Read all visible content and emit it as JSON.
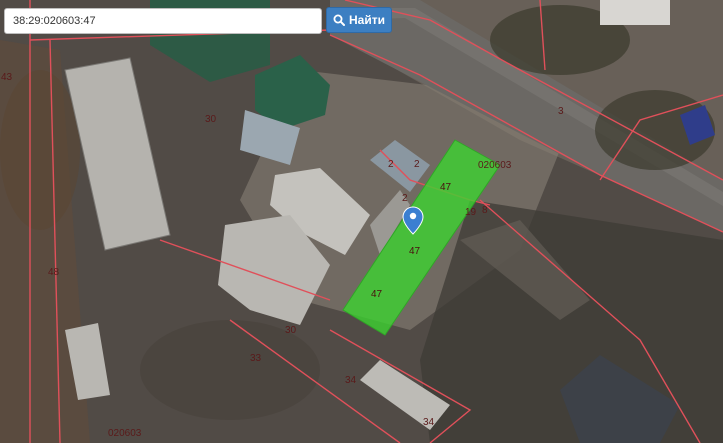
{
  "search": {
    "value": "38:29:020603:47",
    "button_label": "Найти",
    "button_icon": "search-icon"
  },
  "map": {
    "highlight_color": "#3bd62f",
    "boundary_color": "#e0505a",
    "marker_color": "#3b7fd1",
    "labels": {
      "block_number_top": "020603",
      "block_number_bottom": "020603",
      "l3": "3",
      "l8": "8",
      "l19": "19",
      "l2a": "2",
      "l2b": "2",
      "l2c": "2",
      "l30a": "30",
      "l30b": "30",
      "l33": "33",
      "l34a": "34",
      "l34b": "34",
      "l48": "48",
      "l43": "43",
      "l47a": "47",
      "l47b": "47",
      "l47c": "47"
    }
  }
}
